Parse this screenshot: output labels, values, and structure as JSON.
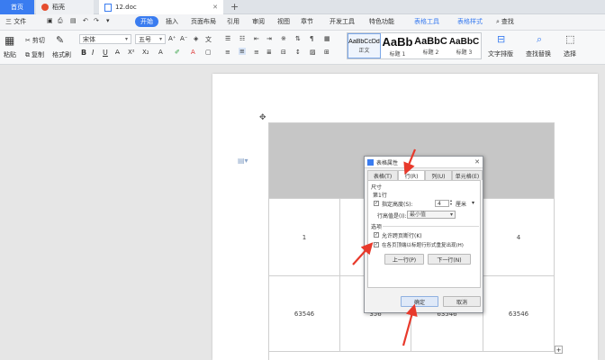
{
  "tabs": {
    "home": "首页",
    "dao": "稻壳",
    "doc": "12.doc"
  },
  "menu": {
    "file": "三 文件",
    "start": "开始",
    "insert": "插入",
    "layout": "页面布局",
    "ref": "引用",
    "review": "审阅",
    "view": "视图",
    "chapter": "章节",
    "dev": "开发工具",
    "special": "特色功能",
    "table_tools": "表格工具",
    "table_style": "表格样式",
    "search": "查找"
  },
  "toolbar": {
    "paste": "粘贴",
    "cut": "剪切",
    "copy": "复制",
    "format_painter": "格式刷",
    "font_name": "宋体",
    "font_size": "五号",
    "bold": "B",
    "italic": "I",
    "underline": "U",
    "text_layout": "文字排版",
    "find_replace": "查找替换",
    "select": "选择"
  },
  "styles": [
    {
      "preview": "AaBbCcDd",
      "label": "正文"
    },
    {
      "preview": "AaBb",
      "label": "标题 1"
    },
    {
      "preview": "AaBbC",
      "label": "标题 2"
    },
    {
      "preview": "AaBbC",
      "label": "标题 3"
    }
  ],
  "table": {
    "row2": [
      "1",
      "",
      "",
      "4"
    ],
    "row3": [
      "63546",
      "356",
      "63546",
      "63546"
    ]
  },
  "dialog": {
    "title": "表格属性",
    "tabs": [
      "表格(T)",
      "行(R)",
      "列(U)",
      "单元格(E)"
    ],
    "section_size": "尺寸",
    "row_label": "第1行",
    "specify_height": "指定高度(S):",
    "height_value": "4",
    "height_unit": "厘米",
    "row_height_is": "行高值是(I):",
    "row_height_mode": "最小值",
    "section_options": "选项",
    "allow_break": "允许跨页断行(K)",
    "repeat_header": "在各页顶端以标题行形式重复出现(H)",
    "prev_row": "上一行(P)",
    "next_row": "下一行(N)",
    "ok": "确定",
    "cancel": "取消"
  },
  "colors": {
    "accent": "#3a7cf0",
    "arrow": "#e8392b",
    "header_cell": "#c6c6c6"
  }
}
